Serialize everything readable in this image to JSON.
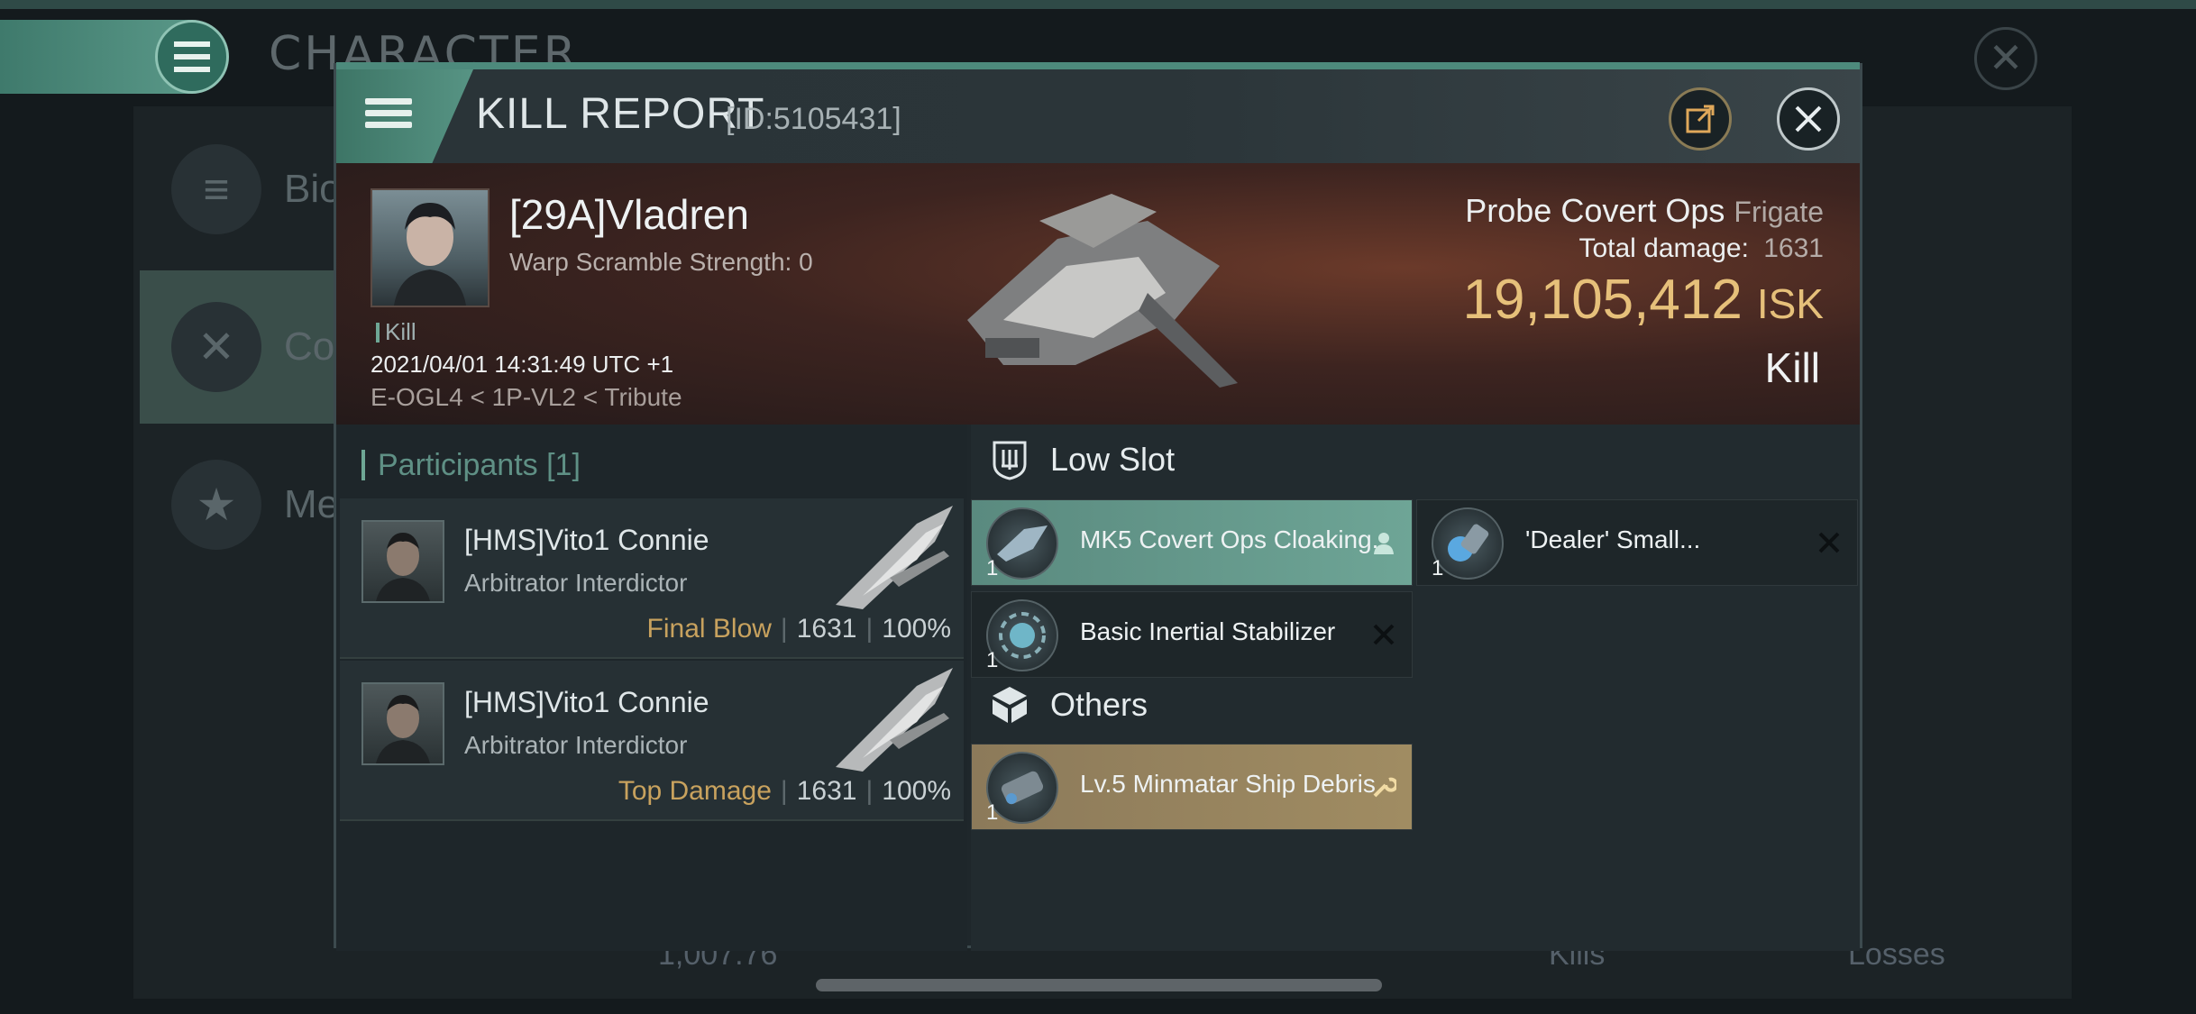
{
  "background": {
    "title": "CHARACTER",
    "sidebar": [
      {
        "label": "Bio",
        "icon": "menu-icon"
      },
      {
        "label": "Cor",
        "icon": "crossed-swords-icon"
      },
      {
        "label": "Me",
        "icon": "star-badge-icon"
      }
    ],
    "bottom": {
      "value": "1,007.76",
      "kills": "Kills",
      "losses": "Losses"
    }
  },
  "modal": {
    "title": "KILL REPORT",
    "id": "[ID:5105431]"
  },
  "victim": {
    "name": "[29A]Vladren",
    "warp_scramble": "Warp Scramble Strength: 0",
    "tag": "Kill",
    "timestamp": "2021/04/01 14:31:49 UTC +1",
    "location": "E-OGL4 < 1P-VL2 < Tribute",
    "ship_name": "Probe Covert Ops",
    "ship_class": "Frigate",
    "total_damage_label": "Total damage:",
    "total_damage": "1631",
    "isk_value": "19,105,412",
    "isk_unit": "ISK",
    "result": "Kill"
  },
  "participants": {
    "header": "Participants [1]",
    "rows": [
      {
        "name": "[HMS]Vito1 Connie",
        "ship": "Arbitrator Interdictor",
        "label": "Final Blow",
        "damage": "1631",
        "percent": "100%"
      },
      {
        "name": "[HMS]Vito1 Connie",
        "ship": "Arbitrator Interdictor",
        "label": "Top Damage",
        "damage": "1631",
        "percent": "100%"
      }
    ]
  },
  "slots": {
    "low_slot_title": "Low Slot",
    "low_items": [
      {
        "name": "MK5 Covert Ops Cloaking...",
        "qty": "1",
        "state": "dropped"
      },
      {
        "name": "'Dealer' Small...",
        "qty": "1",
        "state": "destroyed"
      },
      {
        "name": "Basic Inertial Stabilizer",
        "qty": "1",
        "state": "destroyed"
      }
    ],
    "others_title": "Others",
    "other_items": [
      {
        "name": "Lv.5 Minmatar Ship Debris",
        "qty": "1",
        "state": "dropped"
      }
    ]
  },
  "colors": {
    "accent_teal": "#5d9c8c",
    "isk_gold": "#e6c07a",
    "final_blow": "#c8a25e"
  }
}
